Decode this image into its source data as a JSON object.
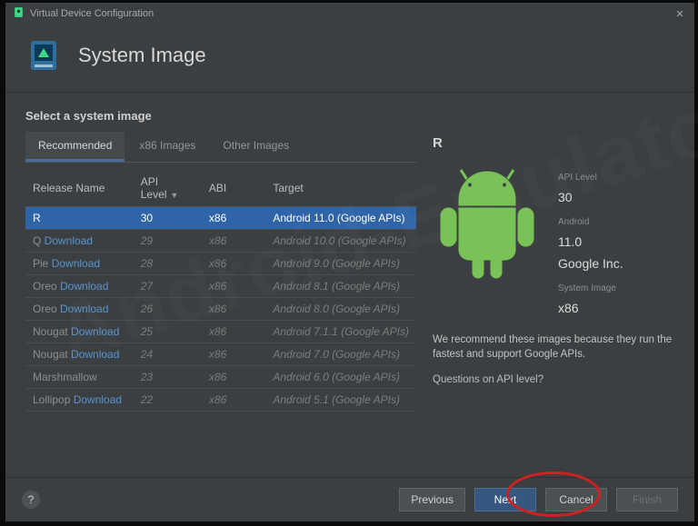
{
  "titlebar": {
    "title": "Virtual Device Configuration"
  },
  "header": {
    "page_title": "System Image"
  },
  "section": {
    "title": "Select a system image"
  },
  "tabs": [
    {
      "label": "Recommended",
      "active": true
    },
    {
      "label": "x86 Images",
      "active": false
    },
    {
      "label": "Other Images",
      "active": false
    }
  ],
  "columns": {
    "release": "Release Name",
    "api": "API Level",
    "abi": "ABI",
    "target": "Target"
  },
  "rows": [
    {
      "release": "R",
      "download": "",
      "api": "30",
      "abi": "x86",
      "target": "Android 11.0 (Google APIs)",
      "selected": true
    },
    {
      "release": "Q",
      "download": "Download",
      "api": "29",
      "abi": "x86",
      "target": "Android 10.0 (Google APIs)",
      "selected": false
    },
    {
      "release": "Pie",
      "download": "Download",
      "api": "28",
      "abi": "x86",
      "target": "Android 9.0 (Google APIs)",
      "selected": false
    },
    {
      "release": "Oreo",
      "download": "Download",
      "api": "27",
      "abi": "x86",
      "target": "Android 8.1 (Google APIs)",
      "selected": false
    },
    {
      "release": "Oreo",
      "download": "Download",
      "api": "26",
      "abi": "x86",
      "target": "Android 8.0 (Google APIs)",
      "selected": false
    },
    {
      "release": "Nougat",
      "download": "Download",
      "api": "25",
      "abi": "x86",
      "target": "Android 7.1.1 (Google APIs)",
      "selected": false
    },
    {
      "release": "Nougat",
      "download": "Download",
      "api": "24",
      "abi": "x86",
      "target": "Android 7.0 (Google APIs)",
      "selected": false
    },
    {
      "release": "Marshmallow",
      "download": "",
      "api": "23",
      "abi": "x86",
      "target": "Android 6.0 (Google APIs)",
      "selected": false
    },
    {
      "release": "Lollipop",
      "download": "Download",
      "api": "22",
      "abi": "x86",
      "target": "Android 5.1 (Google APIs)",
      "selected": false
    }
  ],
  "detail": {
    "name": "R",
    "api_level_label": "API Level",
    "api_level": "30",
    "android_label": "Android",
    "android_version": "11.0",
    "vendor": "Google Inc.",
    "sysimg_label": "System Image",
    "sysimg": "x86",
    "recommend": "We recommend these images because they run the fastest and support Google APIs.",
    "question": "Questions on API level?"
  },
  "footer": {
    "previous": "Previous",
    "next": "Next",
    "cancel": "Cancel",
    "finish": "Finish",
    "help": "?"
  },
  "icons": {
    "titlebar": "android-studio-icon",
    "app": "studio-avd-icon",
    "close": "close-icon",
    "android": "android-robot-icon",
    "help": "help-icon",
    "sort": "sort-desc-icon"
  },
  "colors": {
    "accent": "#365880",
    "link": "#5894d0",
    "selection": "#2f65a8"
  },
  "watermark": "Android-Emulator.Club"
}
